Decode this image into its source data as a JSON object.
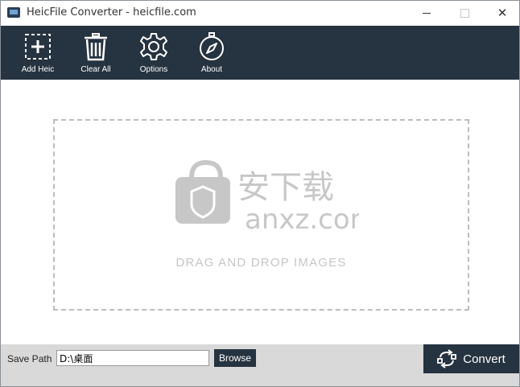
{
  "window": {
    "title": "HeicFile Converter - heicfile.com",
    "close_glyph": "✕"
  },
  "toolbar": {
    "items": [
      {
        "label": "Add Heic",
        "icon": "add-square-icon"
      },
      {
        "label": "Clear All",
        "icon": "trash-icon"
      },
      {
        "label": "Options",
        "icon": "gear-icon"
      },
      {
        "label": "About",
        "icon": "compass-icon"
      }
    ]
  },
  "dropzone": {
    "text": "DRAG AND DROP IMAGES",
    "watermark_text": "安下载",
    "watermark_domain": "anxz.com"
  },
  "bottombar": {
    "save_path_label": "Save Path",
    "save_path_value": "D:\\桌面",
    "browse_label": "Browse",
    "convert_label": "Convert"
  },
  "colors": {
    "toolbar_bg": "#263340",
    "bottombar_bg": "#d9d9d9",
    "dash_border": "#bdbdbd"
  }
}
